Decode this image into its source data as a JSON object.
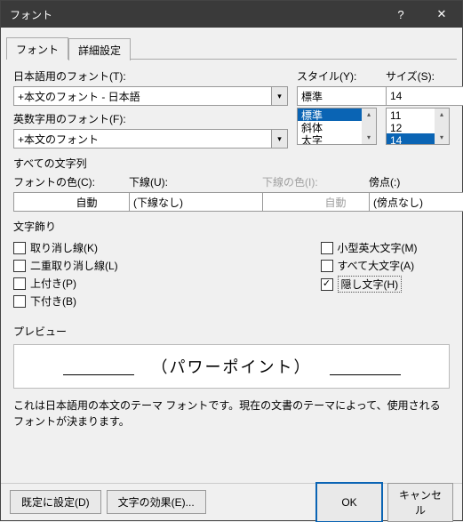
{
  "window": {
    "title": "フォント",
    "help": "?",
    "close": "✕"
  },
  "tabs": {
    "font": "フォント",
    "advanced": "詳細設定"
  },
  "labels": {
    "jp_font": "日本語用のフォント(T):",
    "en_font": "英数字用のフォント(F):",
    "style": "スタイル(Y):",
    "size": "サイズ(S):",
    "all_chars": "すべての文字列",
    "font_color": "フォントの色(C):",
    "underline": "下線(U):",
    "underline_color": "下線の色(I):",
    "emphasis": "傍点(:)",
    "decor": "文字飾り",
    "preview": "プレビュー"
  },
  "values": {
    "jp_font": "+本文のフォント - 日本語",
    "en_font": "+本文のフォント",
    "style": "標準",
    "size": "14",
    "color": "自動",
    "underline": "(下線なし)",
    "ul_color": "自動",
    "emphasis": "(傍点なし)"
  },
  "style_list": [
    "標準",
    "斜体",
    "太字"
  ],
  "size_list": [
    "11",
    "12",
    "14"
  ],
  "checks": {
    "strike": "取り消し線(K)",
    "dstrike": "二重取り消し線(L)",
    "super": "上付き(P)",
    "sub": "下付き(B)",
    "smallcaps": "小型英大文字(M)",
    "allcaps": "すべて大文字(A)",
    "hidden": "隠し文字(H)"
  },
  "preview_text": "（パワーポイント）",
  "desc": "これは日本語用の本文のテーマ フォントです。現在の文書のテーマによって、使用されるフォントが決まります。",
  "buttons": {
    "default": "既定に設定(D)",
    "effects": "文字の効果(E)...",
    "ok": "OK",
    "cancel": "キャンセル"
  }
}
